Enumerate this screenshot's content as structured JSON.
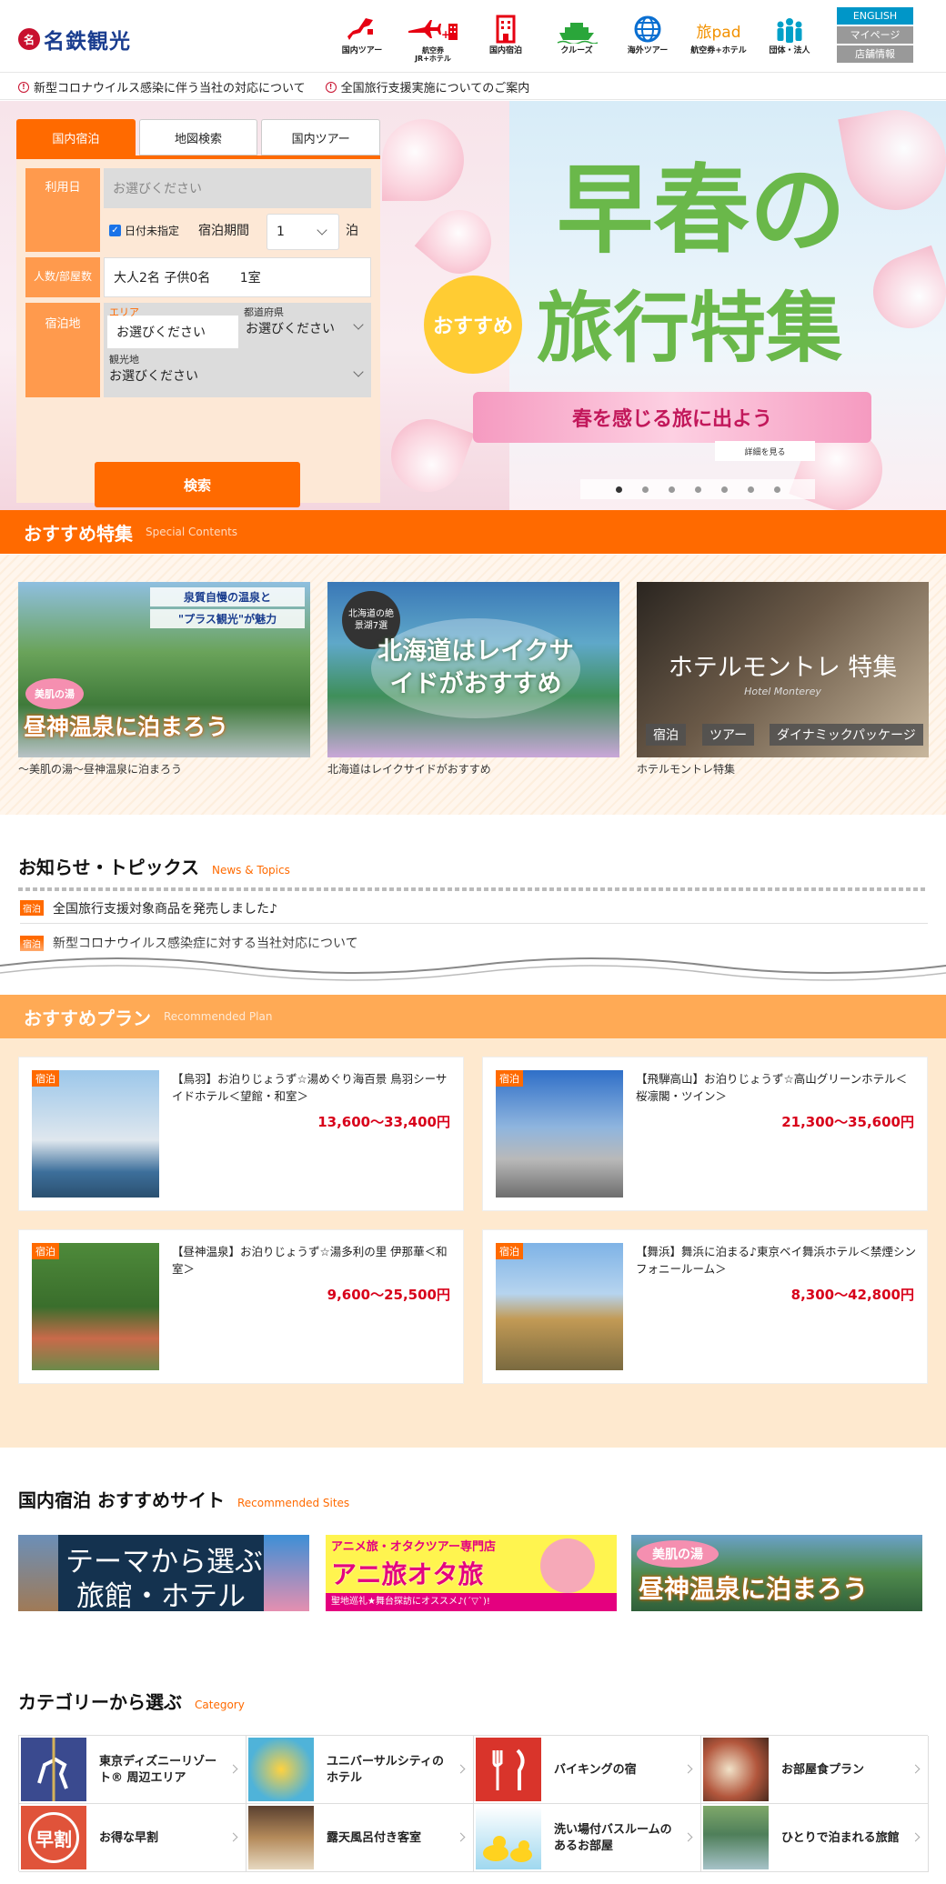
{
  "header": {
    "logo_mark": "名",
    "logo_text": "名鉄観光",
    "nav": [
      {
        "label": "国内ツアー",
        "icon": "japan-map-icon"
      },
      {
        "label": "航空券\nJR+ホテル",
        "icon": "plane-train-hotel-icon"
      },
      {
        "label": "国内宿泊",
        "icon": "hotel-building-icon"
      },
      {
        "label": "クルーズ",
        "icon": "cruise-ship-icon"
      },
      {
        "label": "海外ツアー",
        "icon": "globe-icon"
      },
      {
        "label": "航空券+ホテル",
        "icon": "tabipad-icon",
        "brand": "旅pad"
      },
      {
        "label": "団体・法人",
        "icon": "group-people-icon"
      }
    ],
    "lang": {
      "english": "ENGLISH",
      "mypage": "マイページ",
      "stores": "店舗情報"
    }
  },
  "notices": [
    "新型コロナウイルス感染に伴う当社の対応について",
    "全国旅行支援実施についてのご案内"
  ],
  "search": {
    "tabs": [
      "国内宿泊",
      "地図検索",
      "国内ツアー"
    ],
    "date_label": "利用日",
    "date_placeholder": "お選びください",
    "undecided_label": "日付未指定",
    "period_label": "宿泊期間",
    "nights_value": "1",
    "nights_unit": "泊",
    "people_label": "人数/部屋数",
    "people_value": "大人2名 子供0名　　 1室",
    "place_label": "宿泊地",
    "area_label": "エリア",
    "area_value": "お選びください",
    "pref_label": "都道府県",
    "pref_value": "お選びください",
    "spot_label": "観光地",
    "spot_value": "お選びください",
    "button": "検索"
  },
  "hero": {
    "title_line1": "早春の",
    "title_line2": "旅行特集",
    "badge": "おすすめ",
    "ribbon": "春を感じる旅に出よう",
    "detail_button": "詳細を見る",
    "slide_count": 7,
    "active_slide": 1
  },
  "special": {
    "heading": "おすすめ特集",
    "sub": "Special Contents",
    "items": [
      {
        "caption": "～美肌の湯～昼神温泉に泊まろう",
        "img_line1": "泉質自慢の温泉と",
        "img_line2": "\"プラス観光\"が魅力",
        "img_tag": "美肌の湯",
        "img_title": "昼神温泉に泊まろう"
      },
      {
        "caption": "北海道はレイクサイドがおすすめ",
        "img_badge": "北海道の絶景湖7選",
        "img_title": "北海道はレイクサイドがおすすめ"
      },
      {
        "caption": "ホテルモントレ特集",
        "img_title": "ホテルモントレ 特集",
        "img_sub": "Hotel Monterey",
        "img_tags": [
          "宿泊",
          "ツアー",
          "ダイナミックパッケージ"
        ]
      }
    ]
  },
  "news": {
    "heading": "お知らせ・トピックス",
    "sub": "News & Topics",
    "items": [
      {
        "tag": "宿泊",
        "text": "全国旅行支援対象商品を発売しました♪"
      },
      {
        "tag": "宿泊",
        "text": "新型コロナウイルス感染症に対する当社対応について"
      }
    ]
  },
  "plans": {
    "heading": "おすすめプラン",
    "sub": "Recommended Plan",
    "items": [
      {
        "tag": "宿泊",
        "title": "【鳥羽】お泊りじょうず☆湯めぐり海百景 鳥羽シーサイドホテル＜望館・和室＞",
        "price": "13,600～33,400円"
      },
      {
        "tag": "宿泊",
        "title": "【飛騨高山】お泊りじょうず☆高山グリーンホテル＜桜凛閣・ツイン＞",
        "price": "21,300～35,600円"
      },
      {
        "tag": "宿泊",
        "title": "【昼神温泉】お泊りじょうず☆湯多利の里 伊那華＜和室＞",
        "price": "9,600～25,500円"
      },
      {
        "tag": "宿泊",
        "title": "【舞浜】舞浜に泊まる♪東京ベイ舞浜ホテル＜禁煙シンフォニールーム＞",
        "price": "8,300～42,800円"
      }
    ]
  },
  "sites": {
    "heading": "国内宿泊 おすすめサイト",
    "sub": "Recommended Sites",
    "items": [
      {
        "line1": "テーマから選ぶ",
        "line2": "旅館・ホテル"
      },
      {
        "top": "アニメ旅・オタクツアー専門店",
        "title": "アニ旅オタ旅",
        "bottom": "聖地巡礼★舞台探訪にオススメ♪(´▽`)!"
      },
      {
        "tag": "美肌の湯",
        "title": "昼神温泉に泊まろう"
      }
    ]
  },
  "category": {
    "heading": "カテゴリーから選ぶ",
    "sub": "Category",
    "items": [
      {
        "label": "東京ディズニーリゾート® 周辺エリア"
      },
      {
        "label": "ユニバーサルシティのホテル"
      },
      {
        "label": "バイキングの宿"
      },
      {
        "label": "お部屋食プラン"
      },
      {
        "label": "お得な早割",
        "img_text": "早割"
      },
      {
        "label": "露天風呂付き客室"
      },
      {
        "label": "洗い場付バスルームのあるお部屋"
      },
      {
        "label": "ひとりで泊まれる旅館"
      }
    ]
  },
  "colors": {
    "brand_orange": "#ff6a00",
    "price_red": "#d8001a",
    "plan_bg": "#fee9cf",
    "logo_blue": "#1a3d8f"
  }
}
